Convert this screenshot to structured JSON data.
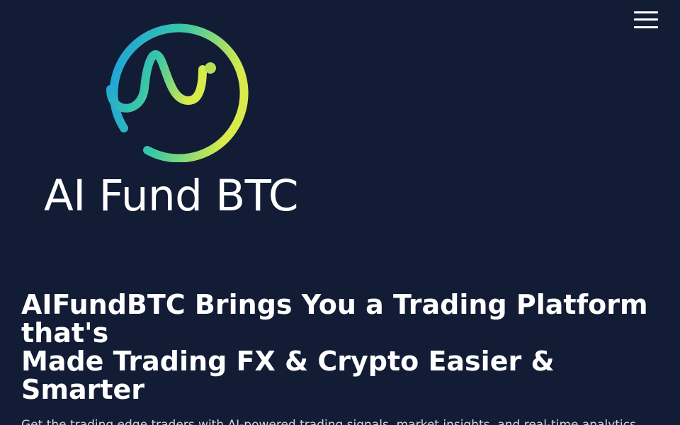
{
  "header": {
    "menu_icon": "hamburger-menu-icon"
  },
  "brand": {
    "logo_icon": "ai-wave-circle-logo",
    "name": "AI Fund BTC",
    "colors": {
      "background": "#121c35",
      "gradient_start": "#1e9fe0",
      "gradient_mid": "#38c7a6",
      "gradient_end": "#d8eb4a"
    }
  },
  "hero": {
    "headline_line1": "AIFundBTC Brings You a Trading Platform that's",
    "headline_line2": "Made Trading FX & Crypto Easier & Smarter",
    "subtext": "Get the trading edge traders with AI-powered trading signals, market insights, and real-time analytics"
  }
}
